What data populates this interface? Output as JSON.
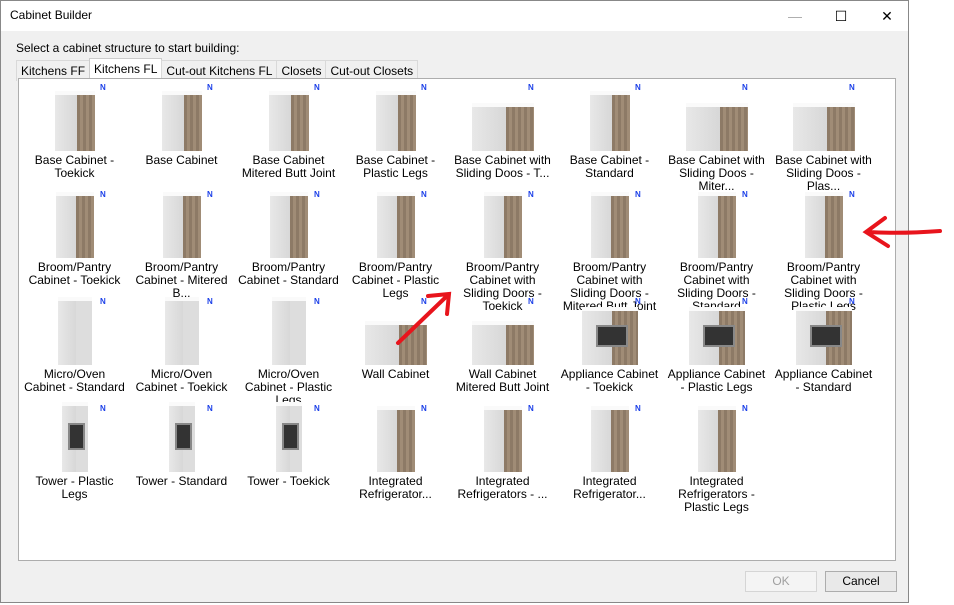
{
  "window": {
    "title": "Cabinet Builder",
    "minimize": "—",
    "maximize": "☐",
    "close": "✕"
  },
  "prompt": "Select a cabinet structure to start building:",
  "tabs": [
    {
      "label": "Kitchens FF"
    },
    {
      "label": "Kitchens FL",
      "active": true
    },
    {
      "label": "Cut-out Kitchens FL"
    },
    {
      "label": "Closets"
    },
    {
      "label": "Cut-out Closets"
    }
  ],
  "badge": "N",
  "items": [
    {
      "label": "Base Cabinet - Toekick",
      "type": "base"
    },
    {
      "label": "Base Cabinet",
      "type": "base"
    },
    {
      "label": "Base Cabinet Mitered Butt Joint",
      "type": "base"
    },
    {
      "label": "Base Cabinet - Plastic Legs",
      "type": "base"
    },
    {
      "label": "Base Cabinet with Sliding Doos - T...",
      "type": "wide"
    },
    {
      "label": "Base Cabinet - Standard",
      "type": "base"
    },
    {
      "label": "Base Cabinet with Sliding Doos - Miter...",
      "type": "wide"
    },
    {
      "label": "Base Cabinet with Sliding Doos - Plas...",
      "type": "wide"
    },
    {
      "label": "Broom/Pantry Cabinet - Toekick",
      "type": "tall"
    },
    {
      "label": "Broom/Pantry Cabinet - Mitered B...",
      "type": "tall"
    },
    {
      "label": "Broom/Pantry Cabinet - Standard",
      "type": "tall"
    },
    {
      "label": "Broom/Pantry Cabinet - Plastic Legs",
      "type": "tall"
    },
    {
      "label": "Broom/Pantry Cabinet with Sliding Doors - Toekick",
      "type": "tall"
    },
    {
      "label": "Broom/Pantry Cabinet with Sliding Doors - Mitered Butt Joint",
      "type": "tall"
    },
    {
      "label": "Broom/Pantry Cabinet with Sliding Doors - Standard",
      "type": "tall"
    },
    {
      "label": "Broom/Pantry Cabinet with Sliding Doors - Plastic Legs",
      "type": "tall"
    },
    {
      "label": "Micro/Oven Cabinet - Standard",
      "type": "micro"
    },
    {
      "label": "Micro/Oven Cabinet - Toekick",
      "type": "micro"
    },
    {
      "label": "Micro/Oven Cabinet - Plastic Legs",
      "type": "micro"
    },
    {
      "label": "Wall Cabinet",
      "type": "wall"
    },
    {
      "label": "Wall Cabinet Mitered Butt Joint",
      "type": "wall"
    },
    {
      "label": "Appliance Cabinet - Toekick",
      "type": "appliance"
    },
    {
      "label": "Appliance Cabinet - Plastic Legs",
      "type": "appliance"
    },
    {
      "label": "Appliance Cabinet - Standard",
      "type": "appliance"
    },
    {
      "label": "Tower - Plastic Legs",
      "type": "tower"
    },
    {
      "label": "Tower - Standard",
      "type": "tower"
    },
    {
      "label": "Tower - Toekick",
      "type": "tower"
    },
    {
      "label": "Integrated Refrigerator...",
      "type": "tall"
    },
    {
      "label": "Integrated Refrigerators - ...",
      "type": "tall"
    },
    {
      "label": "Integrated Refrigerator...",
      "type": "tall"
    },
    {
      "label": "Integrated Refrigerators - Plastic Legs",
      "type": "tall"
    }
  ],
  "buttons": {
    "ok": "OK",
    "cancel": "Cancel"
  },
  "colors": {
    "annotation": "#e8141c",
    "badge": "#1b3fe8"
  }
}
